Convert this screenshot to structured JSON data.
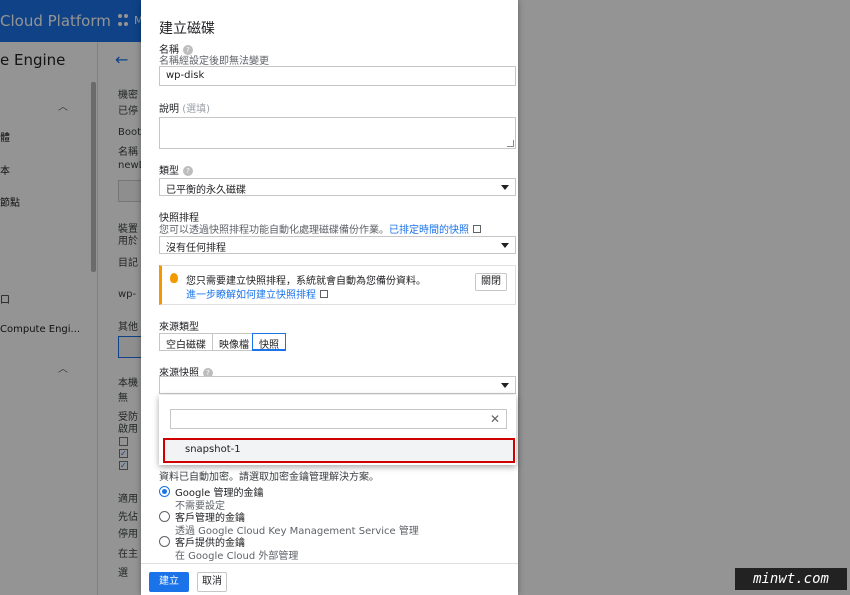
{
  "background": {
    "brand": "Cloud Platform",
    "project_short": "M",
    "section_title": "e Engine",
    "sidebar_items": [
      "體",
      "本",
      "節點",
      "口",
      "Compute Engi..."
    ],
    "main_texts": [
      "機密",
      "已停",
      "Boot",
      "名稱",
      "newD",
      "裝置",
      "用於",
      "目記",
      "wp-",
      "其他",
      "本機",
      "無",
      "受防",
      "啟用",
      "適用",
      "先佔",
      "停用",
      "在主",
      "選"
    ]
  },
  "dialog": {
    "title": "建立磁碟",
    "name_label": "名稱",
    "name_hint": "名稱經設定後即無法變更",
    "name_value": "wp-disk",
    "desc_label": "說明",
    "desc_optional": "(選填)",
    "type_label": "類型",
    "type_value": "已平衡的永久磁碟",
    "schedule_label": "快照排程",
    "schedule_hint": "您可以透過快照排程功能自動化處理磁碟備份作業。",
    "schedule_link": "已排定時間的快照",
    "schedule_value": "沒有任何排程",
    "info_text": "您只需要建立快照排程，系統就會自動為您備份資料。",
    "info_link": "進一步瞭解如何建立快照排程",
    "info_close": "關閉",
    "source_type_label": "來源類型",
    "source_types": [
      "空白磁碟",
      "映像檔",
      "快照"
    ],
    "source_snapshot_label": "來源快照",
    "search_value": "",
    "snapshot_option": "snapshot-1",
    "encryption_text": "資料已自動加密。請選取加密金鑰管理解決方案。",
    "radio1_label": "Google 管理的金鑰",
    "radio1_sub": "不需要設定",
    "radio2_label": "客戶管理的金鑰",
    "radio2_sub": "透過 Google Cloud Key Management Service 管理",
    "radio3_label": "客戶提供的金鑰",
    "radio3_sub": "在 Google Cloud 外部管理",
    "create_button": "建立",
    "cancel_button": "取消"
  },
  "watermark": "minwt.com"
}
